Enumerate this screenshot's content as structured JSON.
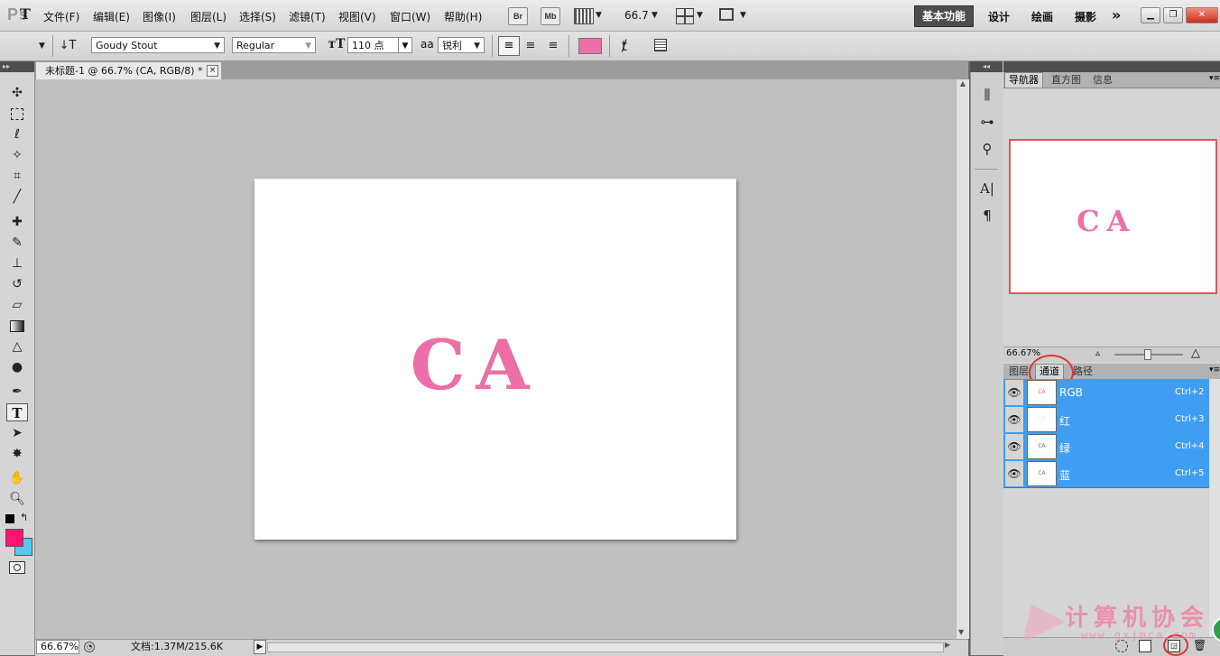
{
  "app": {
    "logo": "Ps"
  },
  "menu": [
    "文件(F)",
    "编辑(E)",
    "图像(I)",
    "图层(L)",
    "选择(S)",
    "滤镜(T)",
    "视图(V)",
    "窗口(W)",
    "帮助(H)"
  ],
  "menubar_tools": {
    "bridge": "Br",
    "mini_bridge": "Mb",
    "zoom_value": "66.7"
  },
  "workspaces": {
    "active": "基本功能",
    "items": [
      "设计",
      "绘画",
      "摄影"
    ],
    "more": "»"
  },
  "options": {
    "tool_glyph": "T",
    "font_family": "Goudy Stout",
    "font_style": "Regular",
    "font_size": "110 点",
    "aa_label": "aa",
    "antialias": "锐利",
    "text_color": "#ee6fa7"
  },
  "document": {
    "tab_title": "未标题-1 @ 66.7% (CA, RGB/8) *",
    "close": "×",
    "text": "CA",
    "text_color": "#ee6fa7"
  },
  "status": {
    "zoom": "66.67%",
    "doc_info": "文档:1.37M/215.6K"
  },
  "tools": [
    "move-tool",
    "marquee-tool",
    "lasso-tool",
    "quick-select-tool",
    "crop-tool",
    "eyedropper-tool",
    "healing-tool",
    "brush-tool",
    "stamp-tool",
    "history-brush-tool",
    "eraser-tool",
    "gradient-tool",
    "blur-tool",
    "dodge-tool",
    "pen-tool",
    "type-tool",
    "path-select-tool",
    "shape-tool",
    "hand-tool",
    "zoom-tool"
  ],
  "colors": {
    "foreground": "#ff1474",
    "background": "#55c8f0",
    "selection": "#3f9ef2"
  },
  "navigator": {
    "tabs": [
      "导航器",
      "直方图",
      "信息"
    ],
    "preview_text": "CA",
    "zoom": "66.67%"
  },
  "channels": {
    "tabs": [
      "图层",
      "通道",
      "路径"
    ],
    "active_tab": "通道",
    "rows": [
      {
        "name": "RGB",
        "shortcut": "Ctrl+2"
      },
      {
        "name": "红",
        "shortcut": "Ctrl+3"
      },
      {
        "name": "绿",
        "shortcut": "Ctrl+4"
      },
      {
        "name": "蓝",
        "shortcut": "Ctrl+5"
      }
    ]
  },
  "watermark": {
    "text": "计算机协会",
    "url": "www.gxjmca.com"
  }
}
